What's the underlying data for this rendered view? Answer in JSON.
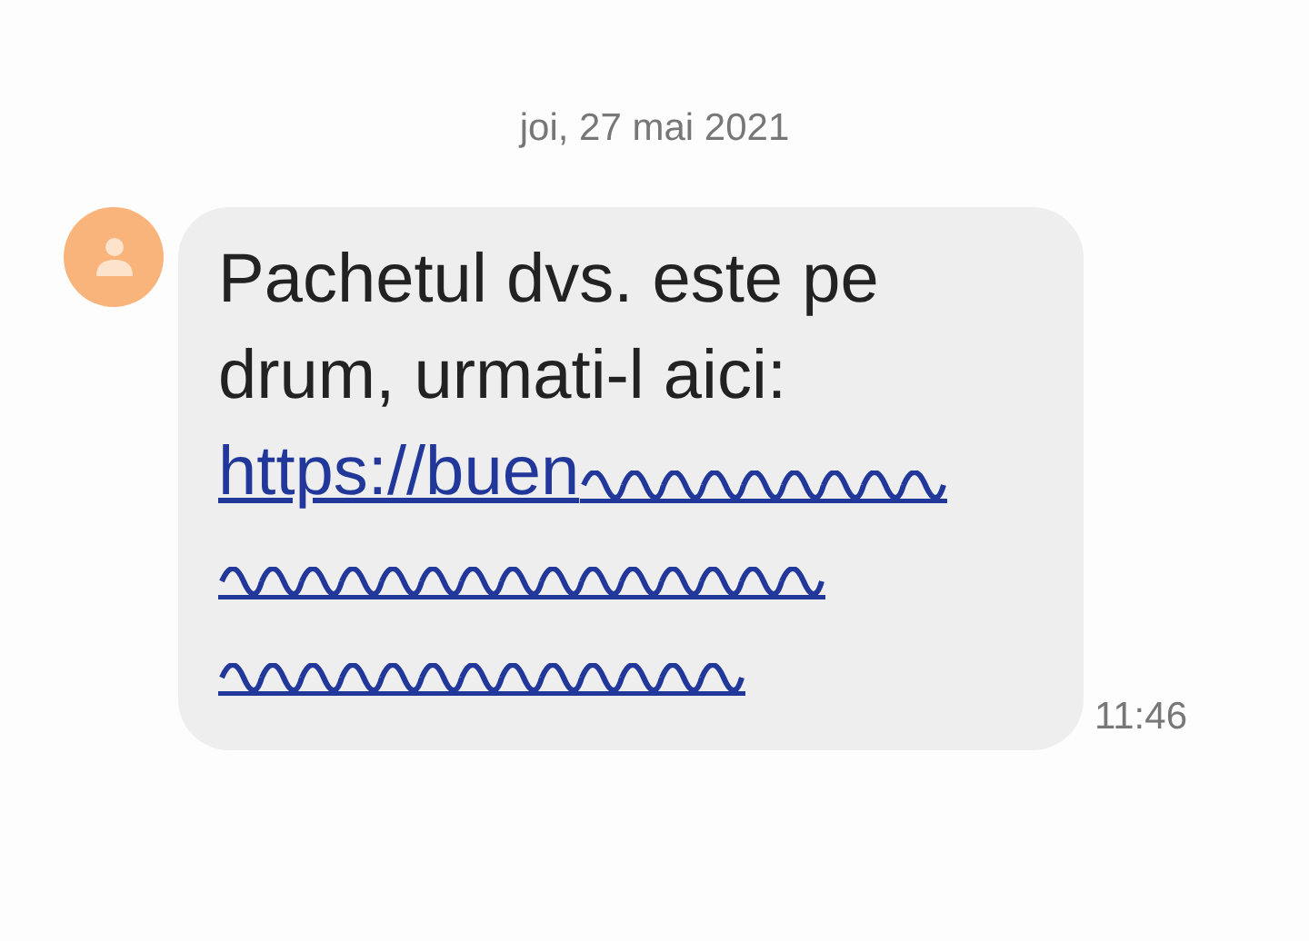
{
  "date": "joi, 27 mai 2021",
  "messages": [
    {
      "text": "Pachetul dvs. este pe drum, urmati-l aici:",
      "link": "https://buen",
      "time": "11:46"
    }
  ]
}
